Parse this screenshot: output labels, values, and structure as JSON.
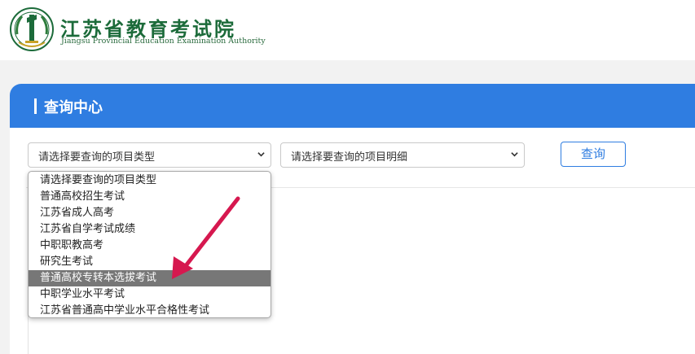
{
  "header": {
    "org_name_cn": "江苏省教育考试院",
    "org_name_en": "Jiangsu Provincial Education Examination Authority",
    "logo_icon": "jiangsu-exam-authority-emblem"
  },
  "panel": {
    "title": "查询中心"
  },
  "filters": {
    "type_select_value": "请选择要查询的项目类型",
    "detail_select_value": "请选择要查询的项目明细",
    "query_button_label": "查询"
  },
  "dropdown": {
    "options": [
      "请选择要查询的项目类型",
      "普通高校招生考试",
      "江苏省成人高考",
      "江苏省自学考试成绩",
      "中职职教高考",
      "研究生考试",
      "普通高校专转本选拔考试",
      "中职学业水平考试",
      "江苏省普通高中学业水平合格性考试"
    ],
    "highlighted_index": 6
  },
  "colors": {
    "brand_blue": "#2f7de1",
    "logo_green": "#1c6b3a",
    "highlight_gray": "#777777",
    "annotation_arrow": "#d6184f"
  }
}
